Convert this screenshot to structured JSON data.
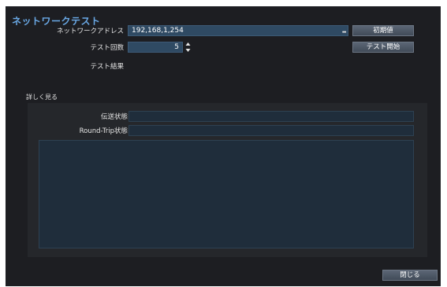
{
  "dialog": {
    "title": "ネットワークテスト",
    "address_label": "ネットワークアドレス",
    "address_value": "192,168,1,254",
    "address_dropdown_symbol": "▂",
    "default_button": "初期値",
    "count_label": "テスト回数",
    "count_value": "5",
    "start_button": "テスト開始",
    "result_label": "テスト結果",
    "details_label": "詳しく見る",
    "transfer_label": "伝送状態",
    "roundtrip_label": "Round-Trip状態",
    "close_button": "閉じる"
  },
  "colors": {
    "background": "#1d1e22",
    "panel": "#25272b",
    "accent_title": "#6aa9e6",
    "field": "#2f4a63"
  }
}
